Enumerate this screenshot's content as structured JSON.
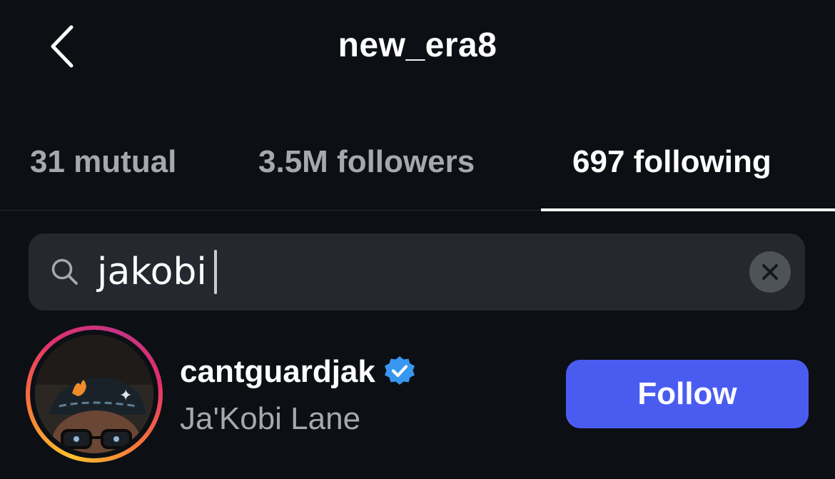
{
  "header": {
    "title": "new_era8",
    "back_icon": "chevron-left-icon"
  },
  "tabs": [
    {
      "label": "31 mutual",
      "active": false
    },
    {
      "label": "3.5M followers",
      "active": false
    },
    {
      "label": "697 following",
      "active": true
    }
  ],
  "search": {
    "value": "jakobi",
    "icon": "search-icon",
    "clear_icon": "close-icon"
  },
  "results": [
    {
      "username": "cantguardjak",
      "verified": true,
      "full_name": "Ja'Kobi Lane",
      "button_label": "Follow"
    }
  ],
  "colors": {
    "background": "#0c0f14",
    "follow_button": "#4a5cf0",
    "verified_badge": "#3897f0",
    "search_bar": "#25282e",
    "muted_text": "#a5a8ae"
  }
}
